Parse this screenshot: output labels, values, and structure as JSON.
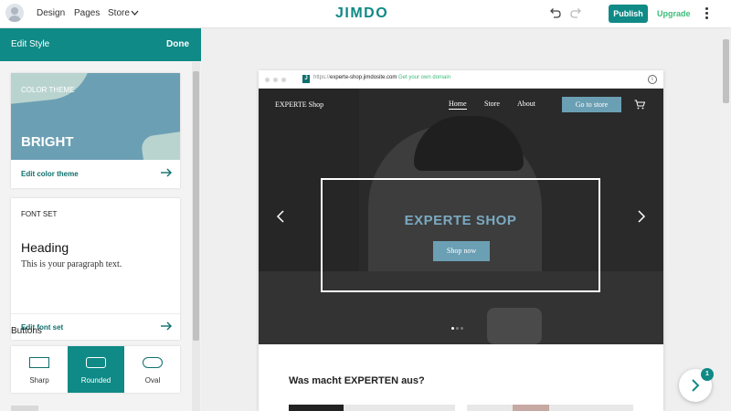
{
  "topbar": {
    "nav": [
      "Design",
      "Pages",
      "Store"
    ],
    "logo": "JIMDO",
    "publish_label": "Publish",
    "upgrade_label": "Upgrade",
    "icons": [
      "avatar-icon",
      "chevron-down-icon",
      "undo-icon",
      "redo-icon",
      "kebab-menu-icon"
    ]
  },
  "sidebar": {
    "title": "Edit Style",
    "done_label": "Done",
    "color_theme": {
      "label": "COLOR THEME",
      "name": "BRIGHT",
      "link": "Edit color theme",
      "colors": {
        "preview": "#6b9fb4",
        "accent": "#b9d4cf"
      }
    },
    "font_set": {
      "label": "FONT SET",
      "heading": "Heading",
      "paragraph": "This is your paragraph text.",
      "link": "Edit font set"
    },
    "buttons": {
      "title": "Buttons",
      "options": [
        "Sharp",
        "Rounded",
        "Oval"
      ],
      "selected": "Rounded"
    }
  },
  "browser": {
    "url_prefix": "https://",
    "url_host": "experte-shop.jimdosite.com",
    "domain_cta": "Get your own domain",
    "site": {
      "brand": "EXPERTE Shop",
      "nav": [
        "Home",
        "Store",
        "About"
      ],
      "active_nav": "Home",
      "cta": "Go to store",
      "hero_title": "EXPERTE SHOP",
      "hero_button": "Shop now",
      "slide_count": 3,
      "active_slide": 1,
      "section_heading": "Was macht EXPERTEN aus?"
    }
  },
  "fab": {
    "badge": "1"
  },
  "colors": {
    "brand": "#0f8a86",
    "upgrade": "#3cbc7a",
    "site_accent": "#6b9fb4"
  }
}
